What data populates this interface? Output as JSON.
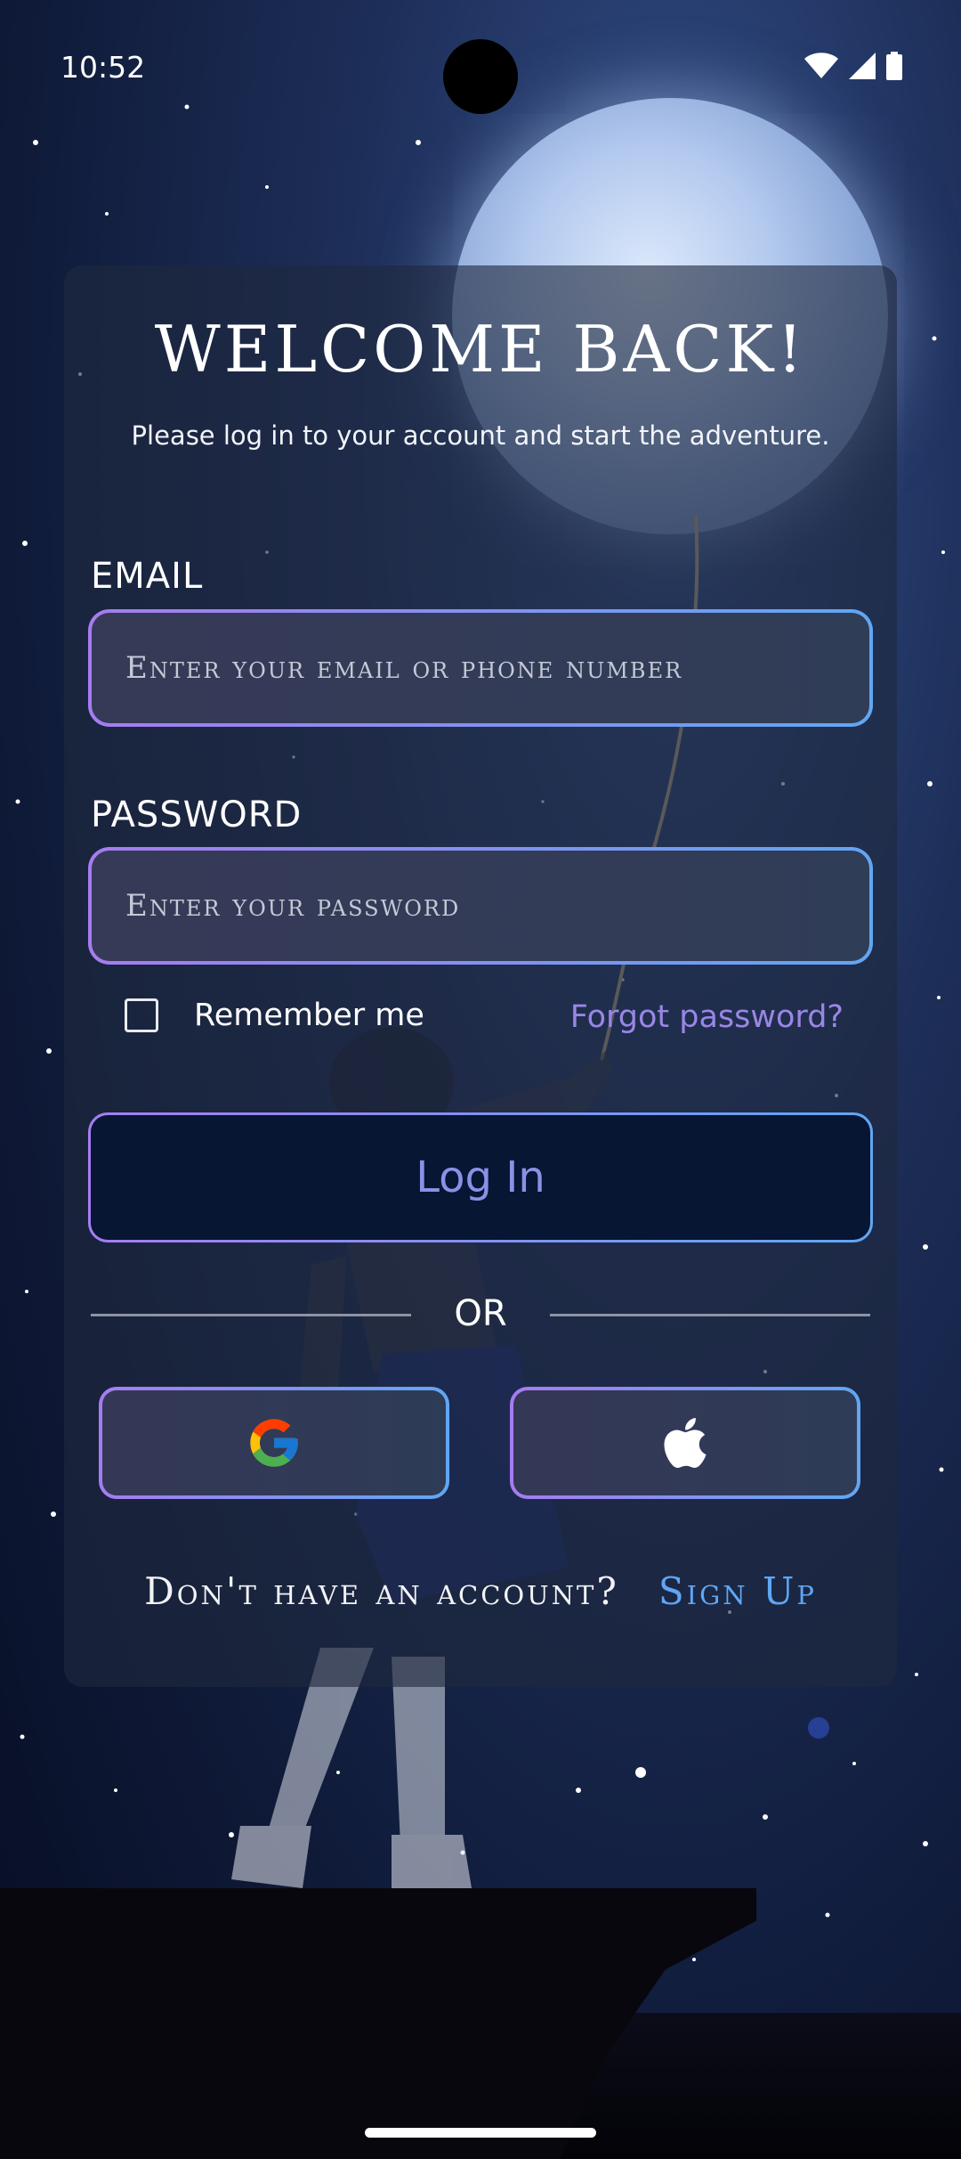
{
  "status_bar": {
    "time": "10:52",
    "icons": [
      "wifi-icon",
      "cell-signal-icon",
      "battery-icon"
    ]
  },
  "login_card": {
    "title": "WELCOME BACK!",
    "subtitle": "Please log in to your account and start the adventure.",
    "email": {
      "label": "EMAIL",
      "placeholder": "Enter your email or phone number",
      "value": ""
    },
    "password": {
      "label": "PASSWORD",
      "placeholder": "Enter your password",
      "value": ""
    },
    "remember_me": {
      "label": "Remember me",
      "checked": false
    },
    "forgot_password": "Forgot password?",
    "login_button": "Log In",
    "divider_text": "OR",
    "social": [
      {
        "provider": "Google",
        "icon": "google-icon"
      },
      {
        "provider": "Apple",
        "icon": "apple-icon"
      }
    ],
    "no_account_text": "Don't have an account?",
    "signup_link": "Sign Up"
  },
  "colors": {
    "accent_purple": "#a67cf0",
    "accent_blue": "#61a6f2",
    "forgot_link": "#9a86e6",
    "signup_link": "#5fa6f5",
    "login_button_bg": "#061633",
    "login_button_text": "#8a91e6"
  }
}
